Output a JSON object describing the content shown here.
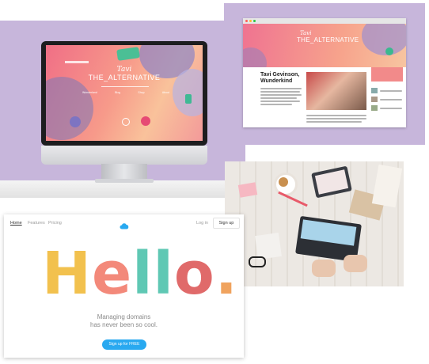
{
  "imac_site": {
    "script_word": "Tavi",
    "brand": "THE_ALTERNATIVE",
    "nav": [
      "Wonderland",
      "Blog",
      "Shop",
      "About"
    ]
  },
  "browser_site": {
    "brand_script": "Tavi",
    "brand": "THE_ALTERNATIVE",
    "article_title_line1": "Tavi Gevinson,",
    "article_title_line2": "Wunderkind"
  },
  "hello_page": {
    "nav": {
      "home": "Home",
      "features": "Features",
      "pricing": "Pricing",
      "login": "Log in",
      "signup": "Sign up"
    },
    "headline_letters": [
      "H",
      "e",
      "l",
      "l",
      "o",
      "."
    ],
    "headline_colors": [
      "#f2c14e",
      "#f3897a",
      "#5fc8b4",
      "#5fc8b4",
      "#e06a6a",
      "#f0a35e"
    ],
    "tagline_line1": "Managing domains",
    "tagline_line2": "has never been so cool.",
    "cta": "Sign up for FREE",
    "logo_icon": "cloud-icon"
  },
  "colors": {
    "lavender": "#c7b6db",
    "cta_blue": "#29a9f0",
    "cloud_blue": "#29a9f0"
  }
}
